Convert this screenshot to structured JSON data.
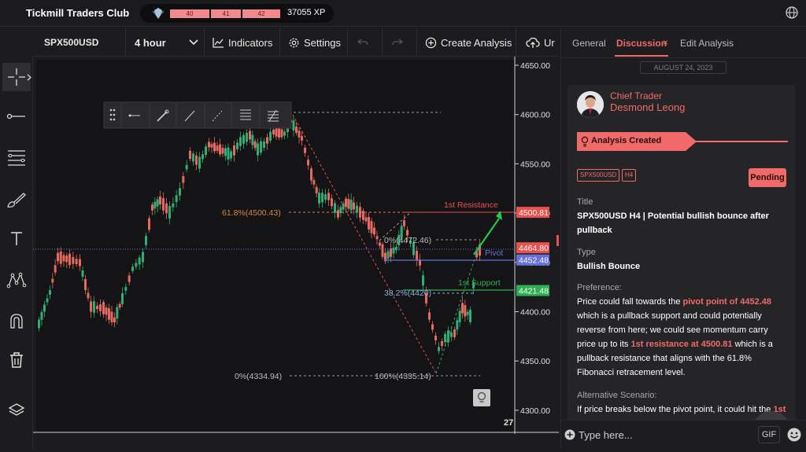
{
  "header": {
    "brand": "Tickmill Traders Club",
    "xp_levels": [
      "40",
      "41",
      "42"
    ],
    "xp_total": "37055 XP"
  },
  "toolbar": {
    "symbol": "SPX500USD",
    "interval": "4 hour",
    "indicators": "Indicators",
    "settings": "Settings",
    "create_analysis": "Create Analysis",
    "upload_label": "Ur"
  },
  "chart": {
    "y_ticks": [
      "4650.00",
      "4600.00",
      "4550.00",
      "4500.00",
      "4450.00",
      "4400.00",
      "4350.00",
      "4300.00"
    ],
    "x_tick": "27",
    "price_tags": [
      {
        "label": "4500.81",
        "color": "#e8514f"
      },
      {
        "label": "4464.80",
        "color": "#e8514f"
      },
      {
        "label": "4452.48",
        "color": "#6670d8"
      },
      {
        "label": "4421.48",
        "color": "#2fae54"
      }
    ],
    "annotations": {
      "resistance": "1st Resistance",
      "pivot": "Pivot",
      "support": "1st Support",
      "fib_618": "61.8%(4500.43)",
      "fib_0_top": "0%(4472.46)",
      "fib_382": "38.2%(4420)",
      "fib_0_bottom": "0%(4334.94)",
      "fib_100": "100%(4335.14)"
    }
  },
  "panel": {
    "tabs": [
      "General",
      "Discussion",
      "Edit Analysis"
    ],
    "date": "AUGUST 24, 2023",
    "author_role": "Chief Trader",
    "author_name": "Desmond Leong",
    "ribbon": "Analysis Created",
    "tags": [
      "SPX500USD",
      "H4"
    ],
    "status": "Pending",
    "title_label": "Title",
    "title_value": "SPX500USD H4 | Potential bullish bounce after pullback",
    "type_label": "Type",
    "type_value": "Bullish Bounce",
    "preference_label": "Preference:",
    "pref_1": "Price could fall towards the ",
    "pref_hl1": "pivot point of 4452.48",
    "pref_2": " which is a pullback support and could potentially reverse from here; we could see momentum carry price up to its ",
    "pref_hl2": "1st resistance at 4500.81",
    "pref_3": " which is a pullback resistance that aligns with the 61.8% Fibonacci retracement level.",
    "alt_label": "Alternative Scenario:",
    "alt_1": "If price breaks below the pivot point, it could hit the ",
    "alt_hl": "1st",
    "input_placeholder": "Type here...",
    "gif": "GIF"
  }
}
